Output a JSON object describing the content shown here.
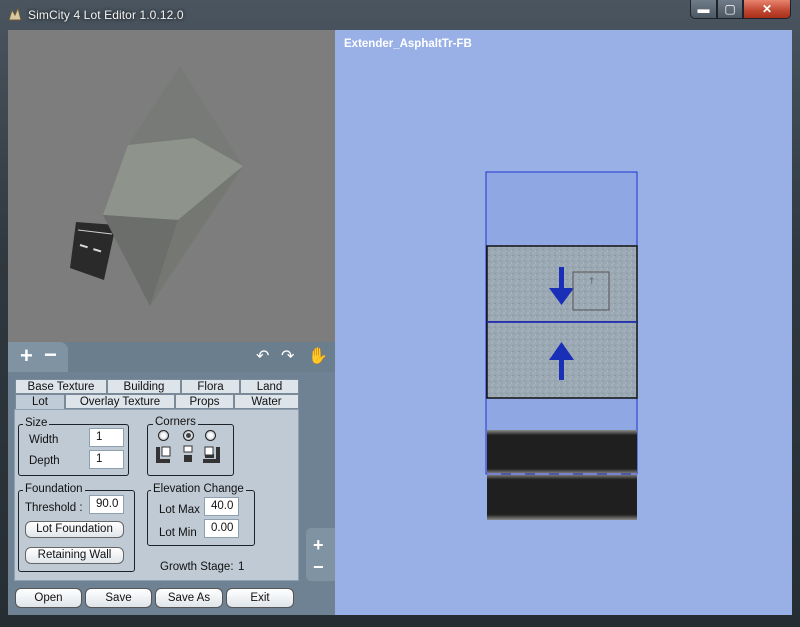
{
  "window": {
    "title": "SimCity 4 Lot Editor 1.0.12.0",
    "controls": {
      "minimize": "▬",
      "maximize": "▢",
      "close": "✕"
    }
  },
  "canvas": {
    "lot_name": "Extender_AsphaltTr-FB"
  },
  "preview_toolbar": {
    "zoom_in": "+",
    "zoom_out": "−"
  },
  "tabs_row1": [
    "Base Texture",
    "Building",
    "Flora",
    "Land"
  ],
  "tabs_row2": [
    "Lot",
    "Overlay Texture",
    "Props",
    "Water"
  ],
  "active_tab": "Lot",
  "size": {
    "label": "Size",
    "width_label": "Width",
    "width_value": "1",
    "depth_label": "Depth",
    "depth_value": "1"
  },
  "corners": {
    "label": "Corners",
    "selected_index": 1
  },
  "foundation": {
    "label": "Foundation",
    "threshold_label": "Threshold :",
    "threshold_value": "90.0",
    "lot_foundation_button": "Lot Foundation",
    "retaining_wall_button": "Retaining Wall"
  },
  "elevation": {
    "label": "Elevation Change",
    "lot_max_label": "Lot Max",
    "lot_max_value": "40.0",
    "lot_min_label": "Lot Min",
    "lot_min_value": "0.00"
  },
  "growth": {
    "label": "Growth Stage:",
    "value": "1"
  },
  "buttons": {
    "open": "Open",
    "save": "Save",
    "save_as": "Save As",
    "exit": "Exit"
  },
  "canvas_zoom": {
    "zoom_in": "+",
    "zoom_out": "−"
  },
  "colors": {
    "canvas_bg": "#99b0e6",
    "arrow": "#1a2fb8",
    "lot_outline": "#2233cc",
    "panel_bg": "#6f8293"
  }
}
